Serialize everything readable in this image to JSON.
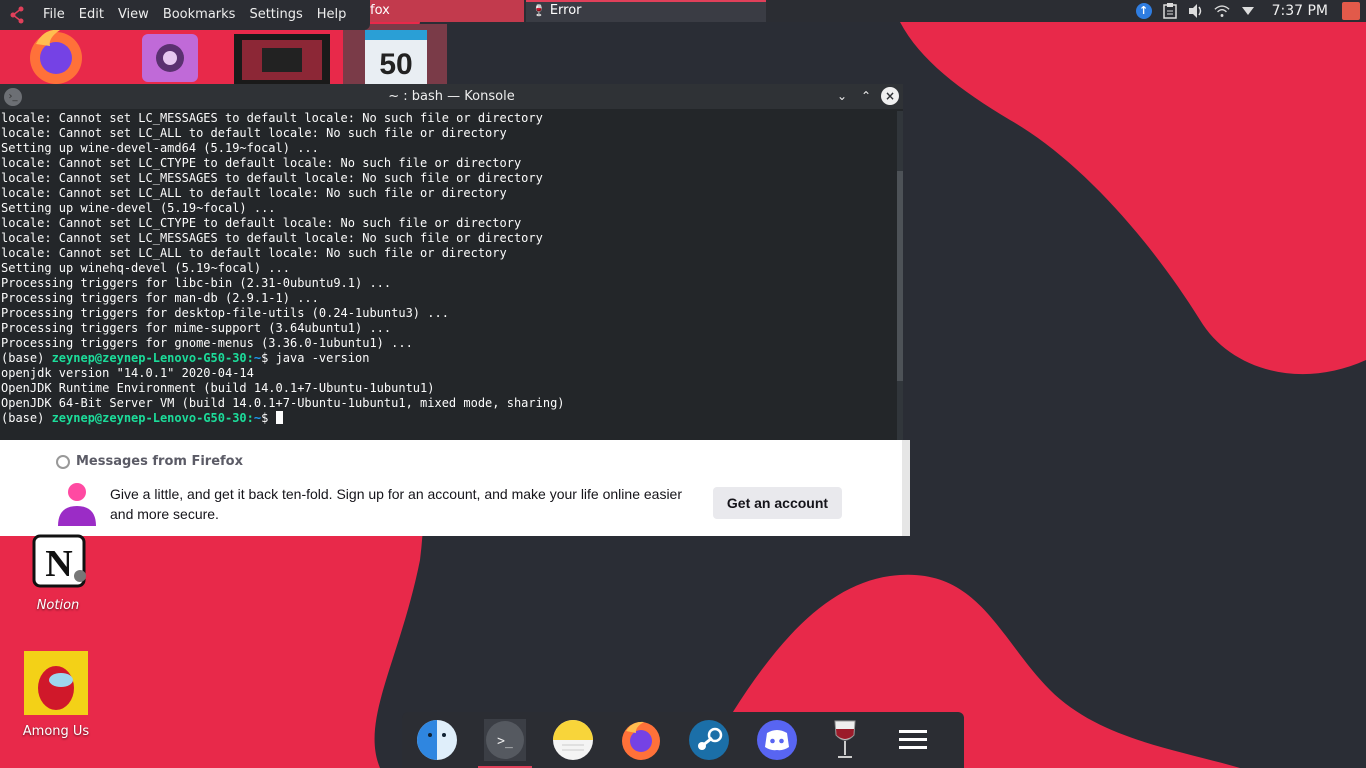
{
  "menubar": {
    "items": [
      "File",
      "Edit",
      "View",
      "Bookmarks",
      "Settings",
      "Help"
    ]
  },
  "taskbar": {
    "tabs": [
      {
        "label": "fox",
        "icon": "firefox-icon"
      },
      {
        "label": "Error",
        "icon": "wine-icon"
      }
    ]
  },
  "tray": {
    "clock": "7:37 PM",
    "icons": [
      "updates-icon",
      "clipboard-icon",
      "volume-icon",
      "wifi-icon",
      "expand-tray-icon",
      "logout-icon"
    ]
  },
  "konsole": {
    "title": "~ : bash — Konsole",
    "lines": [
      {
        "text": "locale: Cannot set LC_MESSAGES to default locale: No such file or directory"
      },
      {
        "text": "locale: Cannot set LC_ALL to default locale: No such file or directory"
      },
      {
        "text": "Setting up wine-devel-amd64 (5.19~focal) ..."
      },
      {
        "text": "locale: Cannot set LC_CTYPE to default locale: No such file or directory"
      },
      {
        "text": "locale: Cannot set LC_MESSAGES to default locale: No such file or directory"
      },
      {
        "text": "locale: Cannot set LC_ALL to default locale: No such file or directory"
      },
      {
        "text": "Setting up wine-devel (5.19~focal) ..."
      },
      {
        "text": "locale: Cannot set LC_CTYPE to default locale: No such file or directory"
      },
      {
        "text": "locale: Cannot set LC_MESSAGES to default locale: No such file or directory"
      },
      {
        "text": "locale: Cannot set LC_ALL to default locale: No such file or directory"
      },
      {
        "text": "Setting up winehq-devel (5.19~focal) ..."
      },
      {
        "text": "Processing triggers for libc-bin (2.31-0ubuntu9.1) ..."
      },
      {
        "text": "Processing triggers for man-db (2.9.1-1) ..."
      },
      {
        "text": "Processing triggers for desktop-file-utils (0.24-1ubuntu3) ..."
      },
      {
        "text": "Processing triggers for mime-support (3.64ubuntu1) ..."
      },
      {
        "text": "Processing triggers for gnome-menus (3.36.0-1ubuntu1) ..."
      }
    ],
    "prompt1": {
      "prefix": "(base) ",
      "user": "zeynep@zeynep-Lenovo-G50-30",
      "sep": ":",
      "path": "~",
      "suffix": "$ java -version"
    },
    "output": [
      "openjdk version \"14.0.1\" 2020-04-14",
      "OpenJDK Runtime Environment (build 14.0.1+7-Ubuntu-1ubuntu1)",
      "OpenJDK 64-Bit Server VM (build 14.0.1+7-Ubuntu-1ubuntu1, mixed mode, sharing)"
    ],
    "prompt2": {
      "prefix": "(base) ",
      "user": "zeynep@zeynep-Lenovo-G50-30",
      "sep": ":",
      "path": "~",
      "suffix": "$ "
    }
  },
  "firefox_message": {
    "header": "Messages from Firefox",
    "body": "Give a little, and get it back ten-fold. Sign up for an account, and make your life online easier and more secure.",
    "button": "Get an account"
  },
  "desktop_icons": [
    {
      "label": "Notion",
      "icon": "notion-icon"
    },
    {
      "label": "Among Us",
      "icon": "among-us-icon"
    }
  ],
  "dock": {
    "items": [
      "finder-icon",
      "terminal-icon",
      "notes-icon",
      "firefox-icon",
      "steam-icon",
      "discord-icon",
      "wine-icon",
      "menu-icon"
    ]
  },
  "colors": {
    "accent": "#e0405a",
    "wallpaper_red": "#e8294a",
    "wallpaper_dark": "#2a2d35",
    "prompt_user": "#1cdc9a",
    "prompt_path": "#1d99f3"
  }
}
